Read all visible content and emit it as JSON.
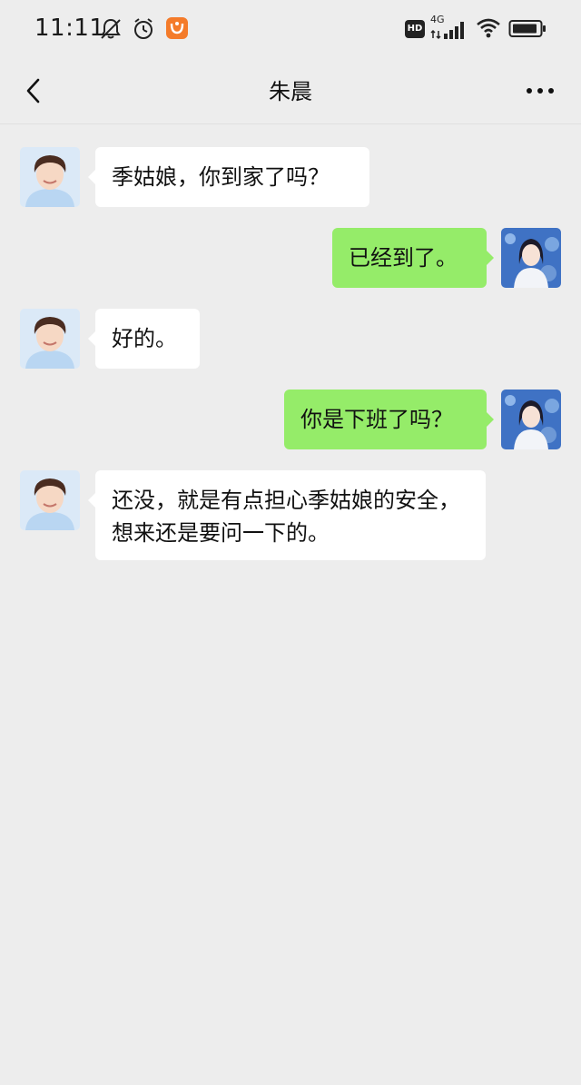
{
  "status_bar": {
    "time": "11:11",
    "hd_badge": "HD",
    "network": "4G",
    "icons": [
      "mute-bell-icon",
      "alarm-icon",
      "app-notification-icon",
      "signal-icon",
      "wifi-icon",
      "battery-icon"
    ]
  },
  "header": {
    "title": "朱晨",
    "back_icon": "chevron-left-icon",
    "more_icon": "more-dots-icon"
  },
  "messages": [
    {
      "sender": "contact",
      "text": "季姑娘，你到家了吗？"
    },
    {
      "sender": "me",
      "text": "已经到了。"
    },
    {
      "sender": "contact",
      "text": "好的。"
    },
    {
      "sender": "me",
      "text": "你是下班了吗？"
    },
    {
      "sender": "contact",
      "text": "还没，就是有点担心季姑娘的安全，想来还是要问一下的。"
    }
  ],
  "colors": {
    "background": "#ededed",
    "incoming_bubble": "#ffffff",
    "outgoing_bubble": "#95ec69",
    "text": "#111111"
  }
}
